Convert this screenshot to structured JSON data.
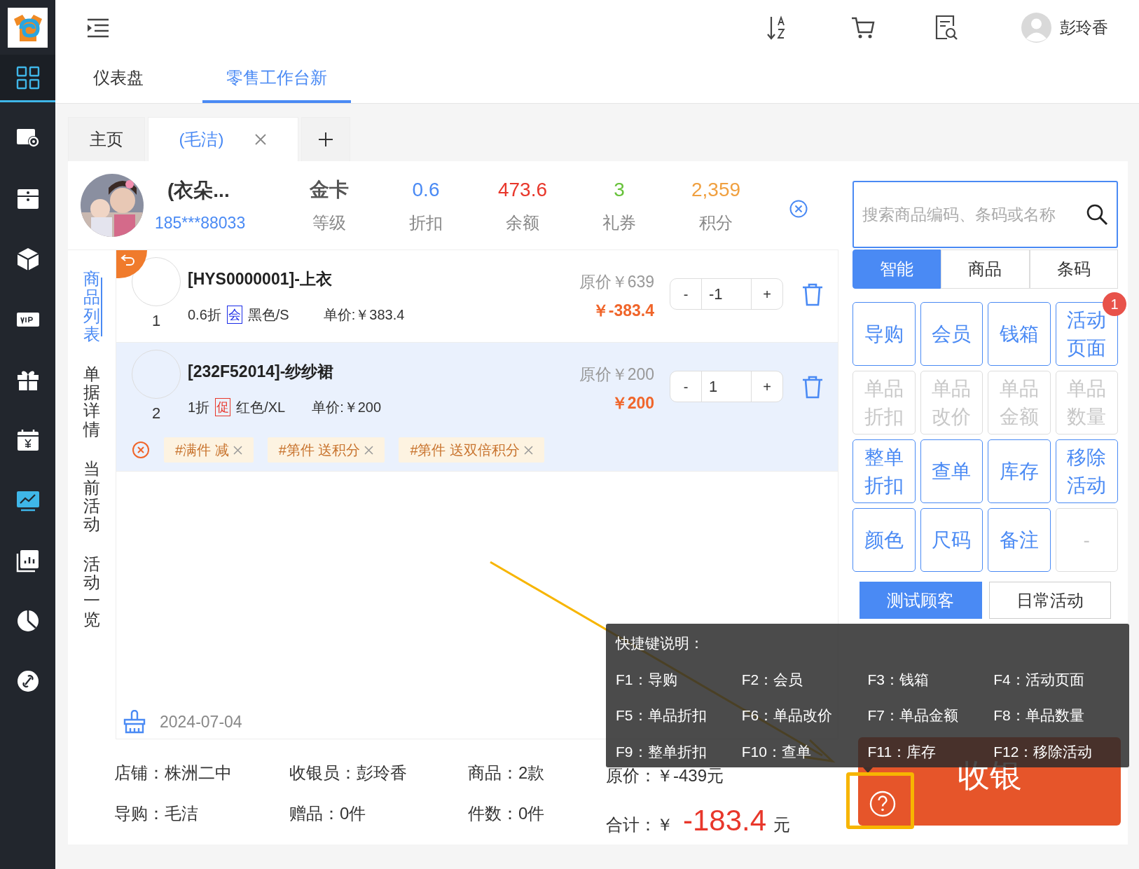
{
  "sidebar": [
    {
      "selected": true,
      "highlighted": true
    },
    {
      "selected": false,
      "highlighted": false
    },
    {
      "selected": false,
      "highlighted": false
    },
    {
      "selected": false,
      "highlighted": false
    },
    {
      "selected": false,
      "highlighted": false
    },
    {
      "selected": false,
      "highlighted": false
    },
    {
      "selected": false,
      "highlighted": false
    },
    {
      "selected": false,
      "highlighted": true
    },
    {
      "selected": false,
      "highlighted": false
    },
    {
      "selected": false,
      "highlighted": false
    },
    {
      "selected": false,
      "highlighted": false
    }
  ],
  "header": {
    "user_name": "彭玲香"
  },
  "nav_tabs": [
    {
      "label": "仪表盘",
      "selected": false
    },
    {
      "label": "零售工作台新",
      "selected": true
    }
  ],
  "doc_tabs": [
    {
      "label": "主页",
      "selected": false,
      "closable": false
    },
    {
      "label": "(毛洁)",
      "selected": true,
      "closable": true
    }
  ],
  "customer": {
    "name": "(衣朵...",
    "phone": "185***88033",
    "stats": [
      {
        "value": "金卡",
        "label": "等级",
        "color": "#555555"
      },
      {
        "value": "0.6",
        "label": "折扣",
        "color": "#4a8af4"
      },
      {
        "value": "473.6",
        "label": "余额",
        "color": "#e8372b"
      },
      {
        "value": "3",
        "label": "礼券",
        "color": "#67c23a"
      },
      {
        "value": "2,359",
        "label": "积分",
        "color": "#f0a040"
      }
    ]
  },
  "side_tabs": [
    {
      "label": "商品列表",
      "selected": true
    },
    {
      "label": "单据详情",
      "selected": false
    },
    {
      "label": "当前活动",
      "selected": false
    },
    {
      "label": "活动一览",
      "selected": false
    }
  ],
  "items": [
    {
      "index": "1",
      "title": "[HYS0000001]-上衣",
      "discount": "0.6折",
      "tag": {
        "text": "会",
        "kind": "member"
      },
      "spec": "黑色/S",
      "unit_price": "单价:￥383.4",
      "original_price": "原价￥639",
      "amount": "￥-383.4",
      "minus": "-",
      "qty": "-1",
      "plus": "+",
      "selected": false,
      "returned": true
    },
    {
      "index": "2",
      "title": "[232F52014]-纱纱裙",
      "discount": "1折",
      "tag": {
        "text": "促",
        "kind": "promo"
      },
      "spec": "红色/XL",
      "unit_price": "单价:￥200",
      "original_price": "原价￥200",
      "amount": "￥200",
      "minus": "-",
      "qty": "1",
      "plus": "+",
      "selected": true,
      "returned": false,
      "promotions": [
        "#满件 减",
        "#第件 送积分",
        "#第件 送双倍积分"
      ]
    }
  ],
  "date": "2024-07-04",
  "search": {
    "placeholder": "搜索商品编码、条码或名称"
  },
  "search_modes": [
    {
      "label": "智能",
      "selected": true
    },
    {
      "label": "商品",
      "selected": false
    },
    {
      "label": "条码",
      "selected": false
    }
  ],
  "actions": [
    {
      "label": "导购",
      "disabled": false
    },
    {
      "label": "会员",
      "disabled": false
    },
    {
      "label": "钱箱",
      "disabled": false
    },
    {
      "label": "活动页面",
      "disabled": false,
      "badge": "1"
    },
    {
      "label": "单品折扣",
      "disabled": true
    },
    {
      "label": "单品改价",
      "disabled": true
    },
    {
      "label": "单品金额",
      "disabled": true
    },
    {
      "label": "单品数量",
      "disabled": true
    },
    {
      "label": "整单折扣",
      "disabled": false
    },
    {
      "label": "查单",
      "disabled": false
    },
    {
      "label": "库存",
      "disabled": false
    },
    {
      "label": "移除活动",
      "disabled": false
    },
    {
      "label": "颜色",
      "disabled": false
    },
    {
      "label": "尺码",
      "disabled": false
    },
    {
      "label": "备注",
      "disabled": false
    },
    {
      "label": "-",
      "disabled": true
    }
  ],
  "customer_buttons": [
    {
      "label": "测试顾客",
      "selected": true
    },
    {
      "label": "日常活动",
      "selected": false
    }
  ],
  "summary": [
    [
      "店铺：株洲二中",
      "导购：毛洁"
    ],
    [
      "收银员：彭玲香",
      "赠品：0件"
    ],
    [
      "商品：2款",
      "件数：0件"
    ]
  ],
  "original_total": "原价：￥-439元",
  "total": {
    "label": "合计：￥",
    "amount": "-183.4",
    "unit": "元"
  },
  "checkout_button": "收银",
  "shortcuts": {
    "title": "快捷键说明：",
    "items": [
      "F1：导购",
      "F2：会员",
      "F3：钱箱",
      "F4：活动页面",
      "F5：单品折扣",
      "F6：单品改价",
      "F7：单品金额",
      "F8：单品数量",
      "F9：整单折扣",
      "F10：查单",
      "F11：库存",
      "F12：移除活动"
    ]
  }
}
